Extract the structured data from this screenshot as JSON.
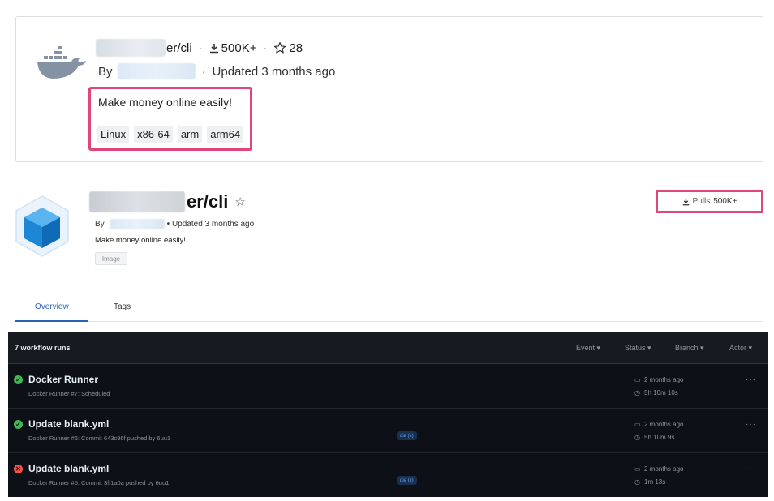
{
  "card1": {
    "repo_suffix": "er/cli",
    "downloads": "500K+",
    "stars": "28",
    "by_label": "By",
    "updated": "Updated 3 months ago",
    "description": "Make money online easily!",
    "tags": [
      "Linux",
      "x86-64",
      "arm",
      "arm64"
    ]
  },
  "card2": {
    "repo_suffix": "er/cli",
    "star_glyph": "☆",
    "by_label": "By",
    "updated": "Updated 3 months ago",
    "description": "Make money online easily!",
    "badge": "Image",
    "pulls_label": "Pulls",
    "pulls_value": "500K+"
  },
  "tabs": [
    "Overview",
    "Tags"
  ],
  "workflow": {
    "count_label": "7 workflow runs",
    "filters": [
      "Event ▾",
      "Status ▾",
      "Branch ▾",
      "Actor ▾"
    ],
    "runs": [
      {
        "status": "success",
        "title": "Docker Runner",
        "subtitle": "Docker Runner #7: Scheduled",
        "branch": "",
        "when": "2 months ago",
        "duration": "5h 10m 10s"
      },
      {
        "status": "success",
        "title": "Update blank.yml",
        "subtitle": "Docker Runner #6: Commit 643c96f pushed by 6uu1",
        "branch": "dia (c)",
        "when": "2 months ago",
        "duration": "5h 10m 9s"
      },
      {
        "status": "failure",
        "title": "Update blank.yml",
        "subtitle": "Docker Runner #5: Commit 3ff1a0a pushed by 6uu1",
        "branch": "dia (c)",
        "when": "2 months ago",
        "duration": "1m 13s"
      }
    ]
  },
  "colors": {
    "highlight": "#e0457b",
    "tab_active": "#2a62b5",
    "success": "#3fb950",
    "failure": "#f85149"
  }
}
